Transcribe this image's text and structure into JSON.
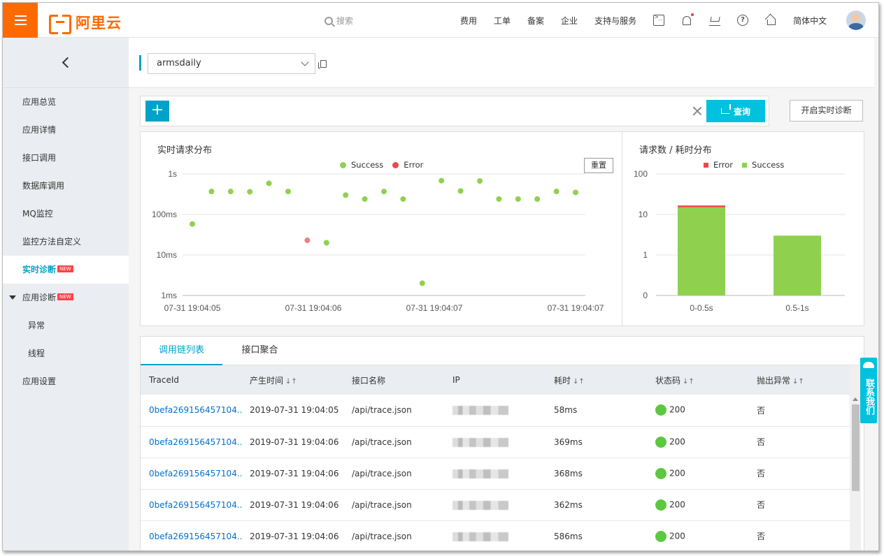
{
  "brand": {
    "logo_text": "阿里云"
  },
  "search": {
    "placeholder": "搜索"
  },
  "top_nav": [
    "费用",
    "工单",
    "备案",
    "企业",
    "支持与服务"
  ],
  "language": "简体中文",
  "sidebar": {
    "items": [
      {
        "label": "应用总览",
        "active": false
      },
      {
        "label": "应用详情",
        "active": false
      },
      {
        "label": "接口调用",
        "active": false
      },
      {
        "label": "数据库调用",
        "active": false
      },
      {
        "label": "MQ监控",
        "active": false
      },
      {
        "label": "监控方法自定义",
        "active": false
      },
      {
        "label": "实时诊断",
        "active": true,
        "badge": "NEW"
      },
      {
        "label": "应用诊断",
        "expanded": true,
        "badge": "NEW"
      },
      {
        "label": "异常",
        "sub": true
      },
      {
        "label": "线程",
        "sub": true
      },
      {
        "label": "应用设置",
        "active": false
      }
    ]
  },
  "app_select": {
    "value": "armsdaily"
  },
  "query": {
    "add_label": "+",
    "query_label": "查询",
    "diagnose_label": "开启实时诊断"
  },
  "scatter": {
    "title": "实时请求分布",
    "reset_label": "重置",
    "legend": [
      {
        "name": "Success",
        "color": "#8fd14f"
      },
      {
        "name": "Error",
        "color": "#f08080"
      }
    ]
  },
  "histogram": {
    "title": "请求数 / 耗时分布",
    "legend": [
      {
        "name": "Error",
        "color": "#f04848"
      },
      {
        "name": "Success",
        "color": "#8fd14f"
      }
    ]
  },
  "chart_data": [
    {
      "type": "scatter",
      "title": "实时请求分布",
      "y_scale": "log",
      "ylim": [
        1,
        1000
      ],
      "y_ticks": [
        "1ms",
        "10ms",
        "100ms",
        "1s"
      ],
      "x_ticks": [
        "07-31 19:04:05",
        "07-31 19:04:06",
        "07-31 19:04:07",
        "07-31 19:04:07"
      ],
      "series": [
        {
          "name": "Success",
          "color": "#8fd14f",
          "values": [
            58,
            369,
            368,
            362,
            586,
            369,
            20,
            300,
            240,
            368,
            240,
            2,
            680,
            380,
            670,
            240,
            240,
            240,
            370,
            350
          ],
          "x": [
            0,
            1,
            2,
            3,
            4,
            5,
            7,
            8,
            9,
            10,
            11,
            12,
            13,
            14,
            15,
            16,
            17,
            18,
            19,
            20
          ]
        },
        {
          "name": "Error",
          "color": "#f08080",
          "values": [
            23
          ],
          "x": [
            6
          ]
        }
      ],
      "grid": true
    },
    {
      "type": "bar",
      "title": "请求数 / 耗时分布",
      "y_scale": "log",
      "y_ticks": [
        "0",
        "1",
        "10",
        "100"
      ],
      "categories": [
        "0-0.5s",
        "0.5-1s"
      ],
      "series": [
        {
          "name": "Success",
          "color": "#8fd14f",
          "values": [
            15,
            3
          ]
        },
        {
          "name": "Error",
          "color": "#f04848",
          "values": [
            1,
            0
          ]
        }
      ],
      "grid": true
    }
  ],
  "tabs": [
    {
      "label": "调用链列表",
      "active": true
    },
    {
      "label": "接口聚合",
      "active": false
    }
  ],
  "table": {
    "headers": [
      "TraceId",
      "产生时间",
      "接口名称",
      "IP",
      "耗时",
      "状态码",
      "抛出异常"
    ],
    "sortable": [
      false,
      true,
      false,
      false,
      true,
      true,
      true
    ],
    "rows": [
      {
        "trace": "0befa269156457104...",
        "time": "2019-07-31 19:04:05",
        "api": "/api/trace.json",
        "cost": "58ms",
        "status": "200",
        "exception": "否"
      },
      {
        "trace": "0befa269156457104...",
        "time": "2019-07-31 19:04:06",
        "api": "/api/trace.json",
        "cost": "369ms",
        "status": "200",
        "exception": "否"
      },
      {
        "trace": "0befa269156457104...",
        "time": "2019-07-31 19:04:06",
        "api": "/api/trace.json",
        "cost": "368ms",
        "status": "200",
        "exception": "否"
      },
      {
        "trace": "0befa269156457104...",
        "time": "2019-07-31 19:04:06",
        "api": "/api/trace.json",
        "cost": "362ms",
        "status": "200",
        "exception": "否"
      },
      {
        "trace": "0befa269156457104...",
        "time": "2019-07-31 19:04:06",
        "api": "/api/trace.json",
        "cost": "586ms",
        "status": "200",
        "exception": "否"
      }
    ]
  },
  "contact": {
    "label": "联系我们"
  }
}
